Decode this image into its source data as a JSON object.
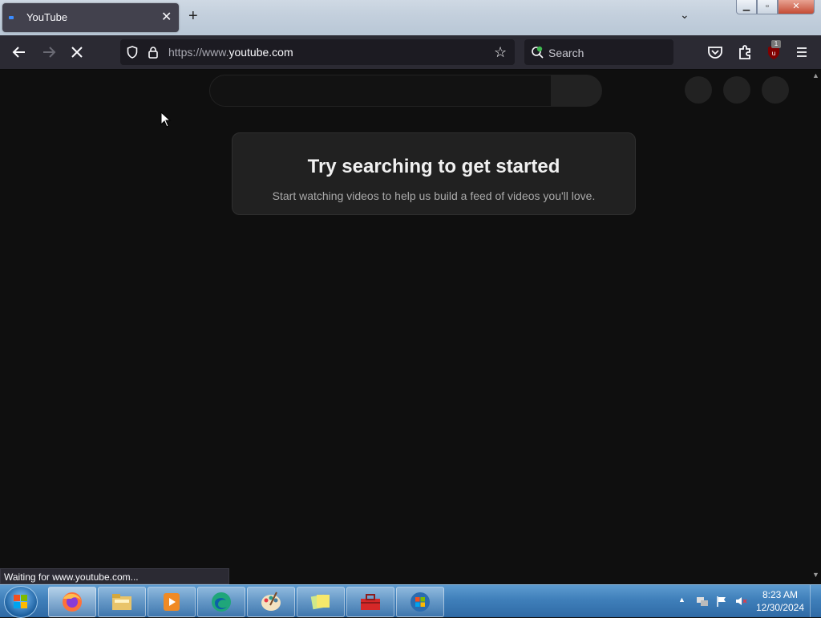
{
  "browser": {
    "tab": {
      "title": "YouTube"
    },
    "new_tab_label": "+",
    "url": {
      "prefix": "https://www.",
      "domain": "youtube.com"
    },
    "search_placeholder": "Search",
    "extension_badge": "1"
  },
  "page": {
    "heading": "Try searching to get started",
    "subtext": "Start watching videos to help us build a feed of videos you'll love."
  },
  "status_text": "Waiting for www.youtube.com...",
  "taskbar": {
    "clock_time": "8:23 AM",
    "clock_date": "12/30/2024",
    "apps": [
      "firefox-icon",
      "file-explorer-icon",
      "media-player-icon",
      "edge-icon",
      "paint-icon",
      "sticky-notes-icon",
      "toolbox-icon",
      "windows-update-icon"
    ]
  },
  "colors": {
    "page_bg": "#0f0f0f",
    "card_bg": "#212121",
    "toolbar_bg": "#2b2a33",
    "taskbar_blue": "#3f7fba"
  }
}
